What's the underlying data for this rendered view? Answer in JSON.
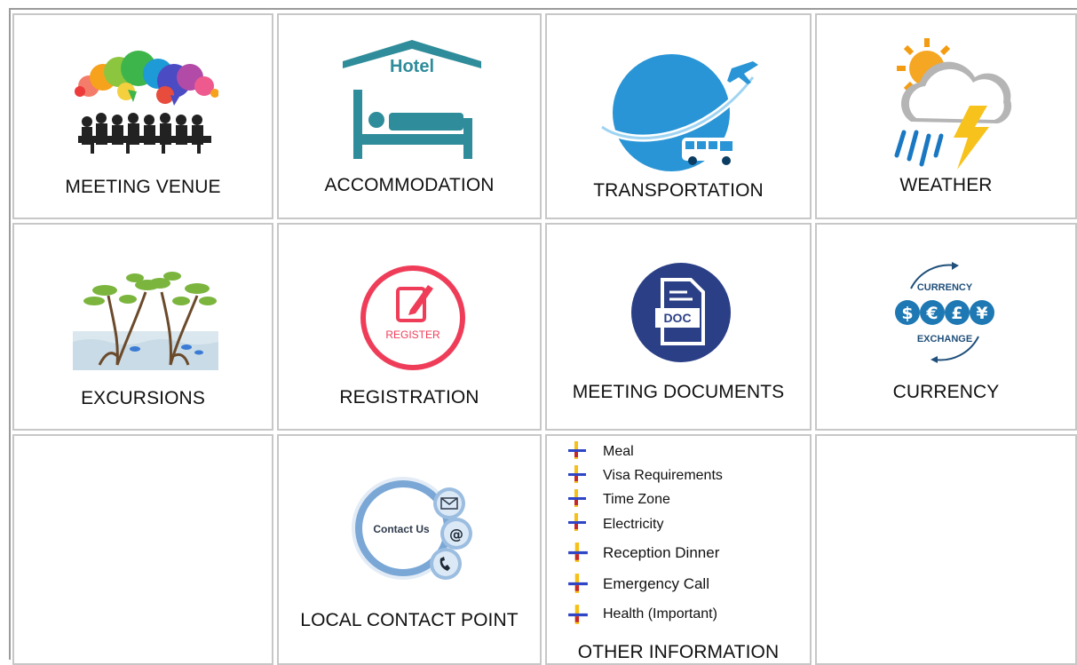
{
  "row1": [
    {
      "label": "MEETING VENUE",
      "icon": "meeting-venue-icon"
    },
    {
      "label": "ACCOMMODATION",
      "icon": "hotel-icon",
      "icon_text": "Hotel"
    },
    {
      "label": "TRANSPORTATION",
      "icon": "transportation-icon"
    },
    {
      "label": "WEATHER",
      "icon": "weather-icon"
    }
  ],
  "row2": [
    {
      "label": "EXCURSIONS",
      "icon": "excursions-icon"
    },
    {
      "label": "REGISTRATION",
      "icon": "register-icon",
      "icon_text": "REGISTER"
    },
    {
      "label": "MEETING DOCUMENTS",
      "icon": "document-icon",
      "icon_text": "DOC"
    },
    {
      "label": "CURRENCY",
      "icon": "currency-exchange-icon",
      "icon_text_top": "CURRENCY",
      "icon_text_bottom": "EXCHANGE",
      "symbols": [
        "$",
        "€",
        "£",
        "¥"
      ]
    }
  ],
  "row3": {
    "contact": {
      "label": "LOCAL CONTACT POINT",
      "icon": "contact-us-icon",
      "icon_text": "Contact Us",
      "at_symbol": "@"
    },
    "other": {
      "label": "OTHER INFORMATION",
      "items": [
        "Meal",
        "Visa Requirements",
        "Time Zone",
        "Electricity",
        "Reception Dinner",
        "Emergency Call",
        "Health (Important)"
      ]
    }
  },
  "colors": {
    "border": "#c7c7c7",
    "hotel": "#2f8c9a",
    "register": "#ef3d59",
    "doc": "#2b3f86",
    "currency": "#1e78b3",
    "globe": "#2a95d6"
  }
}
